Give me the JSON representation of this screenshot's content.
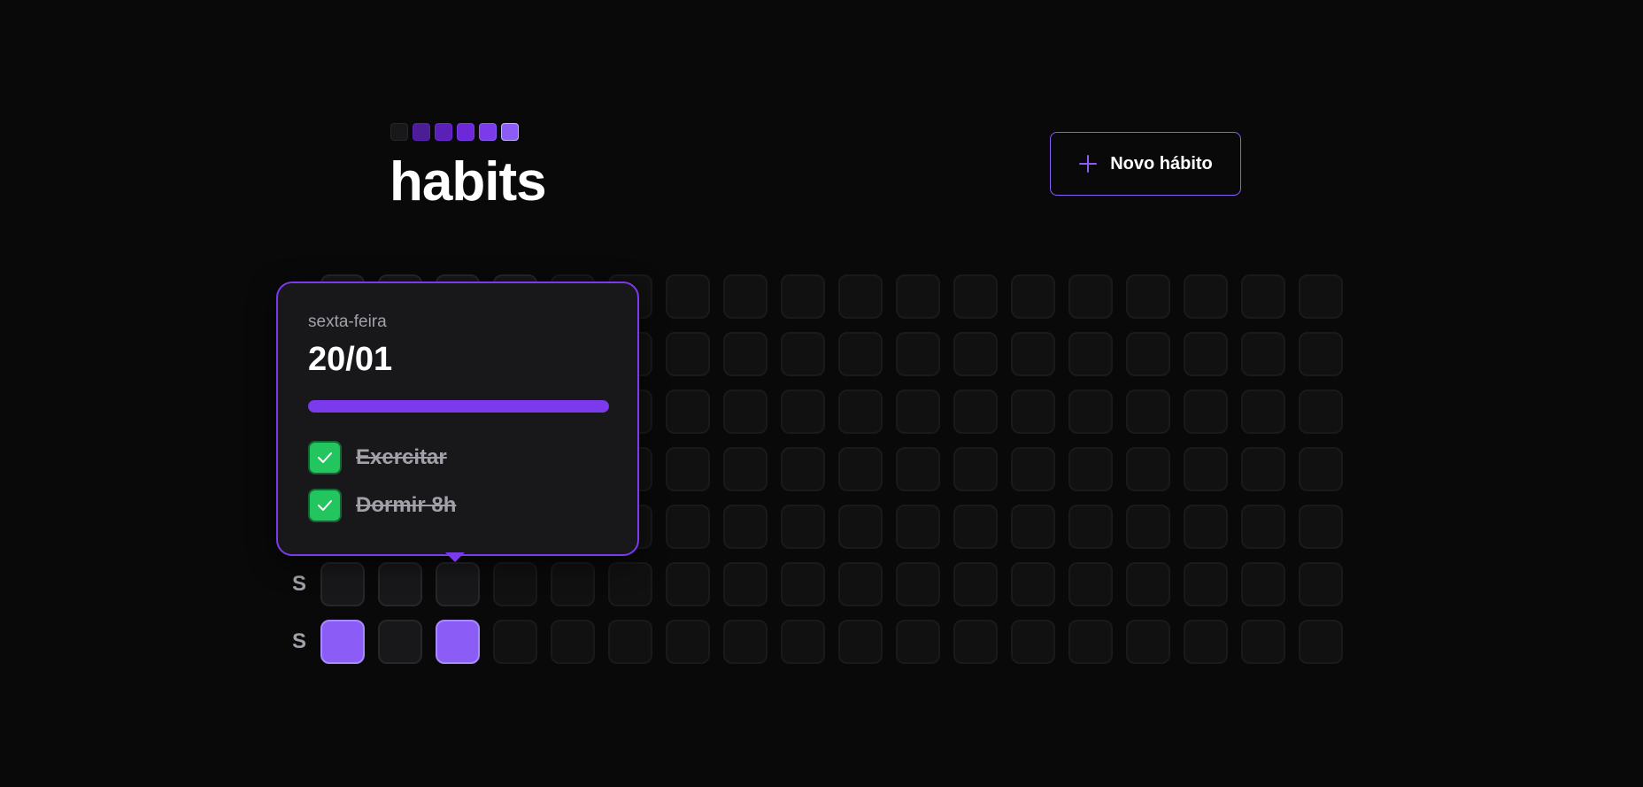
{
  "header": {
    "title": "habits",
    "logo_squares": [
      "#18181b",
      "#4c1d95",
      "#5b21b6",
      "#6d28d9",
      "#7c3aed",
      "#8b5cf6"
    ],
    "new_habit_label": "Novo hábito",
    "new_habit_icon": "plus-icon"
  },
  "colors": {
    "background": "#09090a",
    "accent": "#8b5cf6",
    "accent_border": "#7c3aed",
    "check": "#22c55e",
    "muted_text": "#a1a1aa"
  },
  "grid": {
    "visible_day_labels": [
      "S",
      "S"
    ],
    "completed_cells": [
      "row6-col1",
      "row6-col3",
      "row1-col4"
    ]
  },
  "popover": {
    "weekday": "sexta-feira",
    "date": "20/01",
    "progress": 1.0,
    "habits": [
      {
        "label": "Exercitar",
        "checked": true,
        "icon": "check-icon"
      },
      {
        "label": "Dormir 8h",
        "checked": true,
        "icon": "check-icon"
      }
    ]
  }
}
